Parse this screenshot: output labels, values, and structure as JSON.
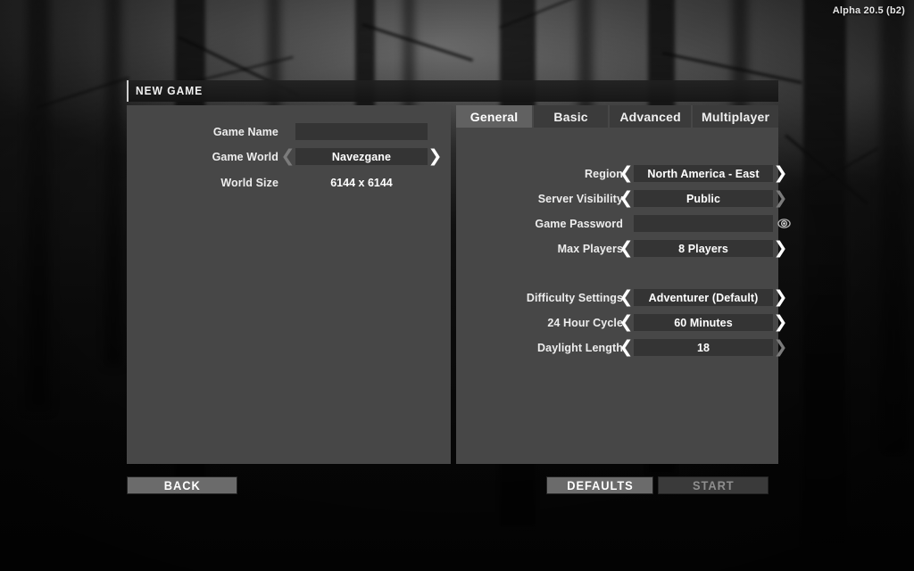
{
  "version_label": "Alpha 20.5 (b2)",
  "window": {
    "title": "NEW GAME"
  },
  "left_panel": {
    "fields": [
      {
        "label": "Game Name",
        "value": "",
        "type": "text",
        "left_arrow": "none",
        "right_arrow": "none"
      },
      {
        "label": "Game World",
        "value": "Navezgane",
        "type": "select",
        "left_arrow": "dim",
        "right_arrow": "active"
      },
      {
        "label": "World Size",
        "value": "6144 x 6144",
        "type": "plain",
        "left_arrow": "none",
        "right_arrow": "none"
      }
    ]
  },
  "tabs": [
    {
      "label": "General",
      "active": true
    },
    {
      "label": "Basic",
      "active": false
    },
    {
      "label": "Advanced",
      "active": false
    },
    {
      "label": "Multiplayer",
      "active": false
    }
  ],
  "right_panel": {
    "group_one": [
      {
        "label": "Region",
        "value": "North America - East",
        "type": "select",
        "left_arrow": "active",
        "right_arrow": "active"
      },
      {
        "label": "Server Visibility",
        "value": "Public",
        "type": "select",
        "left_arrow": "active",
        "right_arrow": "dim"
      },
      {
        "label": "Game Password",
        "value": "",
        "type": "password",
        "left_arrow": "none",
        "right_arrow": "none",
        "reveal_icon": "eye-icon"
      },
      {
        "label": "Max Players",
        "value": "8 Players",
        "type": "select",
        "left_arrow": "active",
        "right_arrow": "active"
      }
    ],
    "group_two": [
      {
        "label": "Difficulty Settings",
        "value": "Adventurer (Default)",
        "type": "select",
        "left_arrow": "active",
        "right_arrow": "active"
      },
      {
        "label": "24 Hour Cycle",
        "value": "60 Minutes",
        "type": "select",
        "left_arrow": "active",
        "right_arrow": "active"
      },
      {
        "label": "Daylight Length",
        "value": "18",
        "type": "select",
        "left_arrow": "active",
        "right_arrow": "dim"
      }
    ]
  },
  "buttons": {
    "back": "BACK",
    "defaults": "DEFAULTS",
    "start": "START"
  },
  "colors": {
    "panel_bg": "#474747",
    "field_bg": "#343434",
    "tab_active_bg": "#616161",
    "tab_inactive_bg": "#3b3b3b",
    "arrow_active": "#ffffff",
    "arrow_dim": "#7b7b7b",
    "button_bg": "#6b6b6b",
    "button_disabled_bg": "#3a3a3a",
    "text": "#ffffff"
  }
}
